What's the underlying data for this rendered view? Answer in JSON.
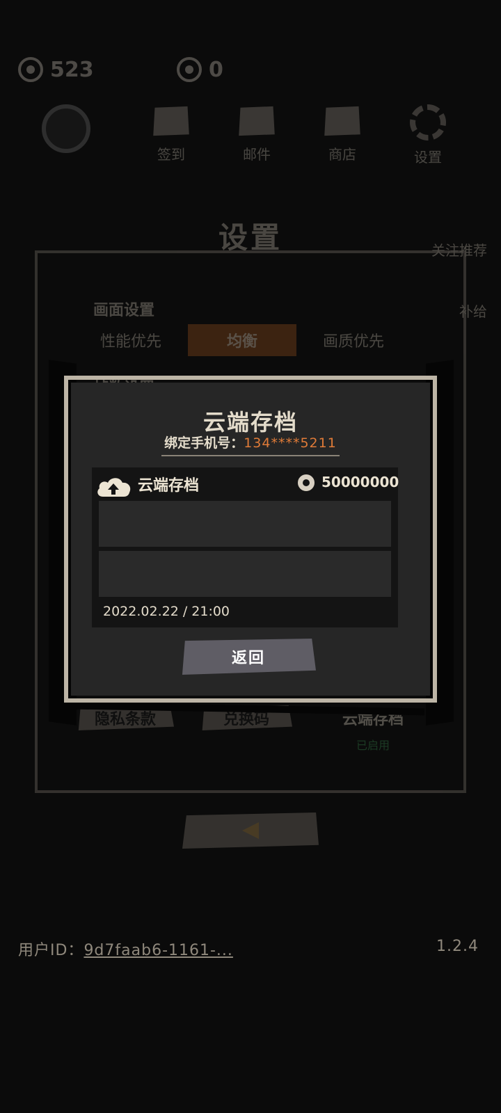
{
  "header": {
    "resources": [
      {
        "icon": "eye-coin-icon",
        "value": "523"
      },
      {
        "icon": "gem-icon",
        "value": "0"
      }
    ],
    "nav": [
      {
        "icon": "calendar-icon",
        "label": "签到"
      },
      {
        "icon": "mail-icon",
        "label": "邮件"
      },
      {
        "icon": "shop-icon",
        "label": "商店"
      },
      {
        "icon": "gear-icon",
        "label": "设置"
      }
    ]
  },
  "settings": {
    "title": "设置",
    "display_section": "画面设置",
    "quality_options": [
      "性能优先",
      "均衡",
      "画质优先"
    ],
    "selected_quality": "均衡",
    "frame_section": "帧数设置",
    "side_labels": [
      "关注推荐",
      "补给"
    ],
    "bottom_options": [
      "隐私条款",
      "兑换码",
      "云端存档"
    ],
    "cloud_status": "已启用"
  },
  "dialog": {
    "title": "云端存档",
    "phone_label": "绑定手机号：",
    "phone_number": "134****5211",
    "save": {
      "label": "云端存档",
      "coins": "50000000",
      "timestamp": "2022.02.22 / 21:00"
    },
    "return_label": "返回"
  },
  "footer": {
    "user_id_label": "用户ID：",
    "user_id": "9d7faab6-1161-...",
    "version": "1.2.4"
  },
  "colors": {
    "accent_orange": "#e07b38",
    "active_segment": "#a3561f",
    "enabled_green": "#3f9e56",
    "button_gray": "#5f5d65"
  }
}
